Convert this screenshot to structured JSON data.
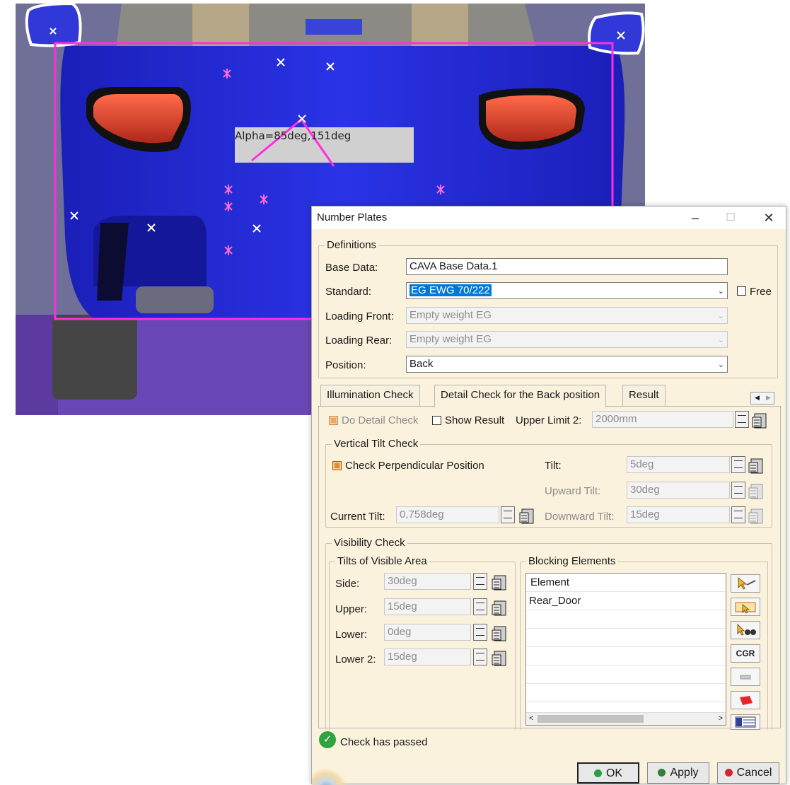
{
  "viewport": {
    "angle_annotation": "Alpha=85deg,151deg"
  },
  "dialog": {
    "title": "Number Plates",
    "window_controls": {
      "minimize": "–",
      "maximize": "☐",
      "close": "✕"
    },
    "definitions": {
      "legend": "Definitions",
      "base_data_label": "Base Data:",
      "base_data_value": "CAVA Base Data.1",
      "standard_label": "Standard:",
      "standard_value": "EG EWG 70/222",
      "free_label": "Free",
      "loading_front_label": "Loading Front:",
      "loading_front_value": "Empty weight EG",
      "loading_rear_label": "Loading Rear:",
      "loading_rear_value": "Empty weight EG",
      "position_label": "Position:",
      "position_value": "Back"
    },
    "tabs": [
      {
        "label": "Illumination Check"
      },
      {
        "label": "Detail Check for the Back position"
      },
      {
        "label": "Result"
      }
    ],
    "detail": {
      "do_detail_check_label": "Do Detail Check",
      "show_result_label": "Show Result",
      "upper_limit_label": "Upper Limit 2:",
      "upper_limit_value": "2000mm"
    },
    "vertical_tilt": {
      "legend": "Vertical Tilt Check",
      "check_perpendicular_label": "Check Perpendicular Position",
      "tilt_label": "Tilt:",
      "tilt_value": "5deg",
      "upward_tilt_label": "Upward Tilt:",
      "upward_tilt_value": "30deg",
      "current_tilt_label": "Current Tilt:",
      "current_tilt_value": "0,758deg",
      "downward_tilt_label": "Downward Tilt:",
      "downward_tilt_value": "15deg"
    },
    "visibility": {
      "legend": "Visibility Check",
      "tilts_legend": "Tilts of Visible Area",
      "side_label": "Side:",
      "side_value": "30deg",
      "upper_label": "Upper:",
      "upper_value": "15deg",
      "lower_label": "Lower:",
      "lower_value": "0deg",
      "lower2_label": "Lower 2:",
      "lower2_value": "15deg",
      "blocking_legend": "Blocking Elements",
      "blocking_rows": [
        "Element",
        "Rear_Door"
      ],
      "cgr_label": "CGR"
    },
    "status_text": "Check has passed",
    "buttons": {
      "ok": "OK",
      "apply": "Apply",
      "cancel": "Cancel"
    },
    "colors": {
      "ok_dot": "#27a243",
      "apply_dot": "#2f7f3a",
      "cancel_dot": "#d8262b",
      "passed": "#2fa33f"
    }
  }
}
